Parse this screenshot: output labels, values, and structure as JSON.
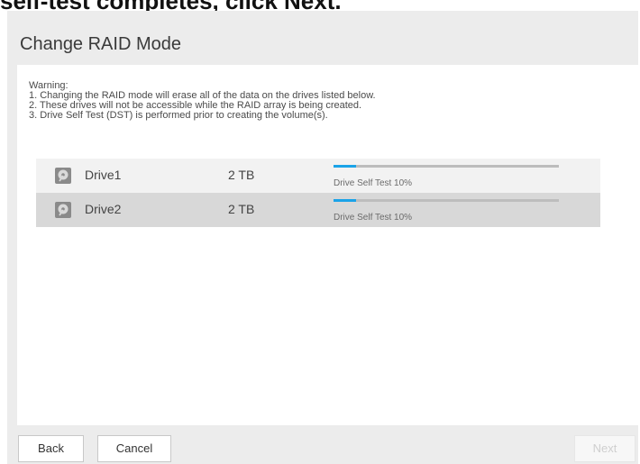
{
  "caption": "self-test completes, click Next.",
  "dialog": {
    "title": "Change RAID Mode",
    "warning": {
      "heading": "Warning:",
      "lines": [
        "1. Changing the RAID mode will erase all of the data on the drives listed below.",
        "2. These drives will not be accessible while the RAID array is being created.",
        "3. Drive Self Test (DST) is performed prior to creating the volume(s)."
      ]
    },
    "drives": [
      {
        "icon": "drive-icon",
        "name": "Drive1",
        "size": "2 TB",
        "progress_label": "Drive Self Test 10%",
        "progress": 0.1
      },
      {
        "icon": "drive-icon",
        "name": "Drive2",
        "size": "2 TB",
        "progress_label": "Drive Self Test 10%",
        "progress": 0.1
      }
    ],
    "buttons": {
      "back": "Back",
      "cancel": "Cancel",
      "next": "Next"
    }
  },
  "colors": {
    "accent": "#1aa3e8",
    "dialog_bg": "#ececec",
    "row_odd": "#f2f2f2",
    "row_even": "#d8d8d8"
  }
}
